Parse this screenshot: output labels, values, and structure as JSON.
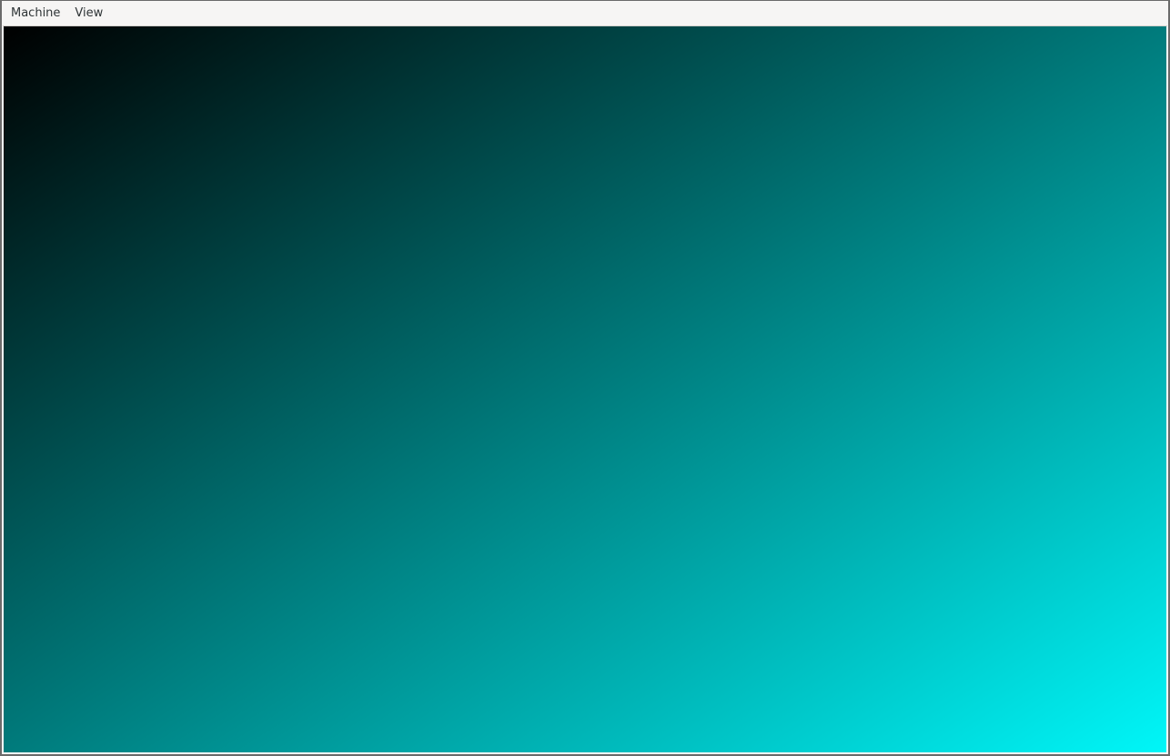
{
  "menubar": {
    "items": [
      {
        "label": "Machine"
      },
      {
        "label": "View"
      }
    ]
  },
  "display": {
    "gradient_start": "#000000",
    "gradient_end": "#00f6f8"
  }
}
